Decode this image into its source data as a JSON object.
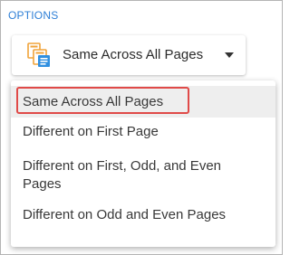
{
  "options": {
    "heading": "OPTIONS",
    "select": {
      "icon": "pages-icon",
      "selected_label": "Same Across All Pages",
      "arrow_icon": "caret-down-icon"
    },
    "menu": {
      "items": [
        {
          "label": "Same Across All Pages"
        },
        {
          "label": "Different on First Page"
        },
        {
          "label": "Different on First, Odd, and Even Pages"
        },
        {
          "label": "Different on Odd and Even Pages"
        }
      ],
      "highlighted_index": 0
    }
  },
  "colors": {
    "heading": "#2e7fd6",
    "icon_orange": "#f0a33a",
    "icon_blue": "#2f8fe0",
    "highlight_border": "#e04a48",
    "hover_background": "#eeeeee"
  }
}
